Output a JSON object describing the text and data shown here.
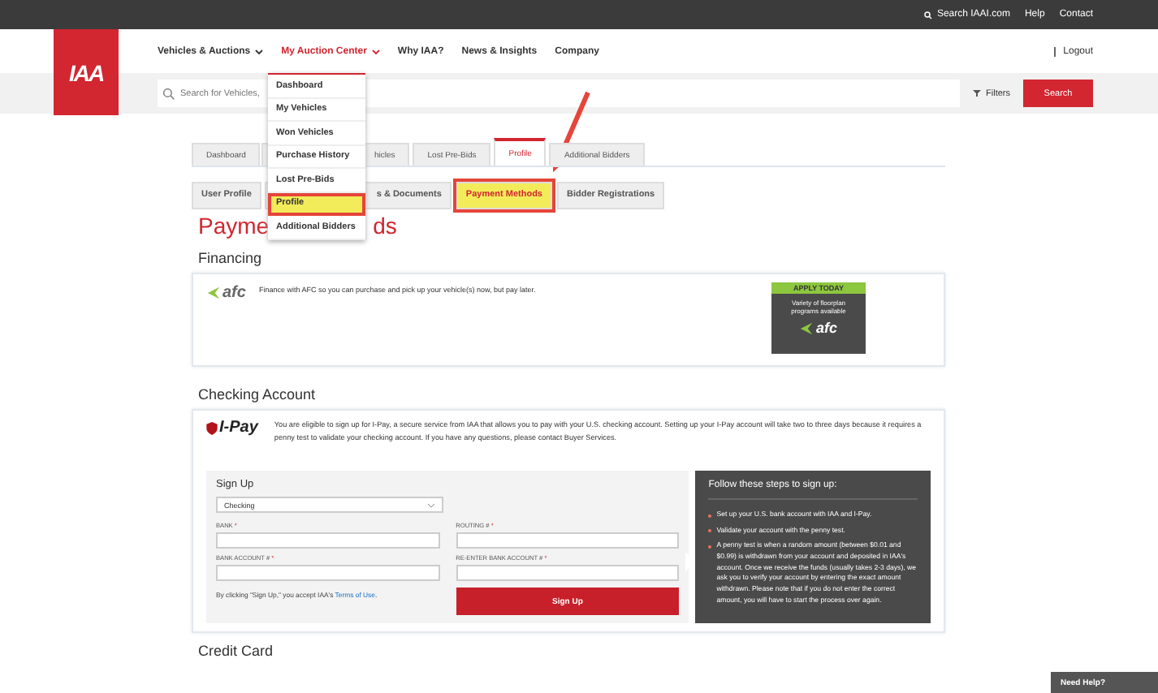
{
  "top_bar": {
    "links": [
      {
        "label": "Search IAAI.com",
        "kind": "search"
      },
      {
        "label": "Help",
        "kind": "link"
      },
      {
        "label": "Contact",
        "kind": "link"
      }
    ]
  },
  "logo": {
    "text": "IAA"
  },
  "nav": {
    "items": [
      {
        "label": "Vehicles & Auctions",
        "has_menu": true,
        "selected": false
      },
      {
        "label": "My Auction Center",
        "has_menu": true,
        "selected": true
      },
      {
        "label": "Why IAA?",
        "has_menu": false,
        "selected": false
      },
      {
        "label": "News & Insights",
        "has_menu": false,
        "selected": false
      },
      {
        "label": "Company",
        "has_menu": false,
        "selected": false
      }
    ],
    "logout": "Logout"
  },
  "search": {
    "placeholder": "Search for Vehicles,",
    "filters": "Filters",
    "button": "Search"
  },
  "dropdown": {
    "items": [
      {
        "label": "Dashboard",
        "highlighted": false
      },
      {
        "label": "My Vehicles",
        "highlighted": false
      },
      {
        "label": "Won Vehicles",
        "highlighted": false
      },
      {
        "label": "Purchase History",
        "highlighted": false
      },
      {
        "label": "Lost Pre-Bids",
        "highlighted": false
      },
      {
        "label": "Profile",
        "highlighted": true
      },
      {
        "label": "Additional Bidders",
        "highlighted": false
      }
    ]
  },
  "tabs": [
    {
      "label": "Dashboard",
      "selected": false,
      "cut": false
    },
    {
      "label": "hicles",
      "selected": false,
      "cut": true
    },
    {
      "label": "Lost Pre-Bids",
      "selected": false,
      "cut": false
    },
    {
      "label": "Profile",
      "selected": true,
      "cut": false
    },
    {
      "label": "Additional Bidders",
      "selected": false,
      "cut": false
    }
  ],
  "sub_tabs": [
    {
      "label": "User Profile",
      "selected": false,
      "highlighted": false,
      "cut": false
    },
    {
      "label": "s & Documents",
      "selected": false,
      "highlighted": false,
      "cut": true
    },
    {
      "label": "Payment Methods",
      "selected": true,
      "highlighted": true,
      "cut": false
    },
    {
      "label": "Bidder Registrations",
      "selected": false,
      "highlighted": false,
      "cut": false
    }
  ],
  "title_fragments": [
    "Payme",
    "ds"
  ],
  "financing": {
    "heading": "Financing",
    "logo": "afc",
    "text": "Finance with AFC so you can purchase and pick up your vehicle(s) now, but pay later.",
    "promo": {
      "badge": "APPLY TODAY",
      "text": "Variety of floorplan programs available",
      "logo": "afc"
    }
  },
  "checking": {
    "heading": "Checking Account",
    "logo": "I-Pay",
    "text": "You are eligible to sign up for I-Pay, a secure service from IAA that allows you to pay with your U.S. checking account. Setting up your I-Pay account will take two to three days because it requires a penny test to validate your checking account. If you have any questions, please contact Buyer Services.",
    "form": {
      "title": "Sign Up",
      "account_type": "Checking",
      "fields": [
        {
          "label": "BANK",
          "mark": "*"
        },
        {
          "label": "ROUTING #",
          "mark": "*"
        },
        {
          "label": "BANK ACCOUNT #",
          "mark": "*"
        },
        {
          "label": "RE-ENTER BANK ACCOUNT #",
          "mark": "*"
        }
      ],
      "terms_before": "By clicking \"Sign Up,\" you accept IAA's ",
      "terms_link": "Terms of Use",
      "terms_after": ".",
      "button": "Sign Up"
    },
    "steps": {
      "title": "Follow these steps to sign up:",
      "items": [
        "Set up your U.S. bank account with IAA and I-Pay.",
        "Validate your account with the penny test.",
        "A penny test is when a random amount (between $0.01 and $0.99) is withdrawn from your account and deposited in IAA's account. Once we receive the funds (usually takes 2-3 days), we ask you to verify your account by entering the exact amount withdrawn. Please note that if you do not enter the correct amount, you will have to start the process over again."
      ]
    }
  },
  "credit_card": {
    "heading": "Credit Card"
  },
  "help_button": "Need Help?"
}
